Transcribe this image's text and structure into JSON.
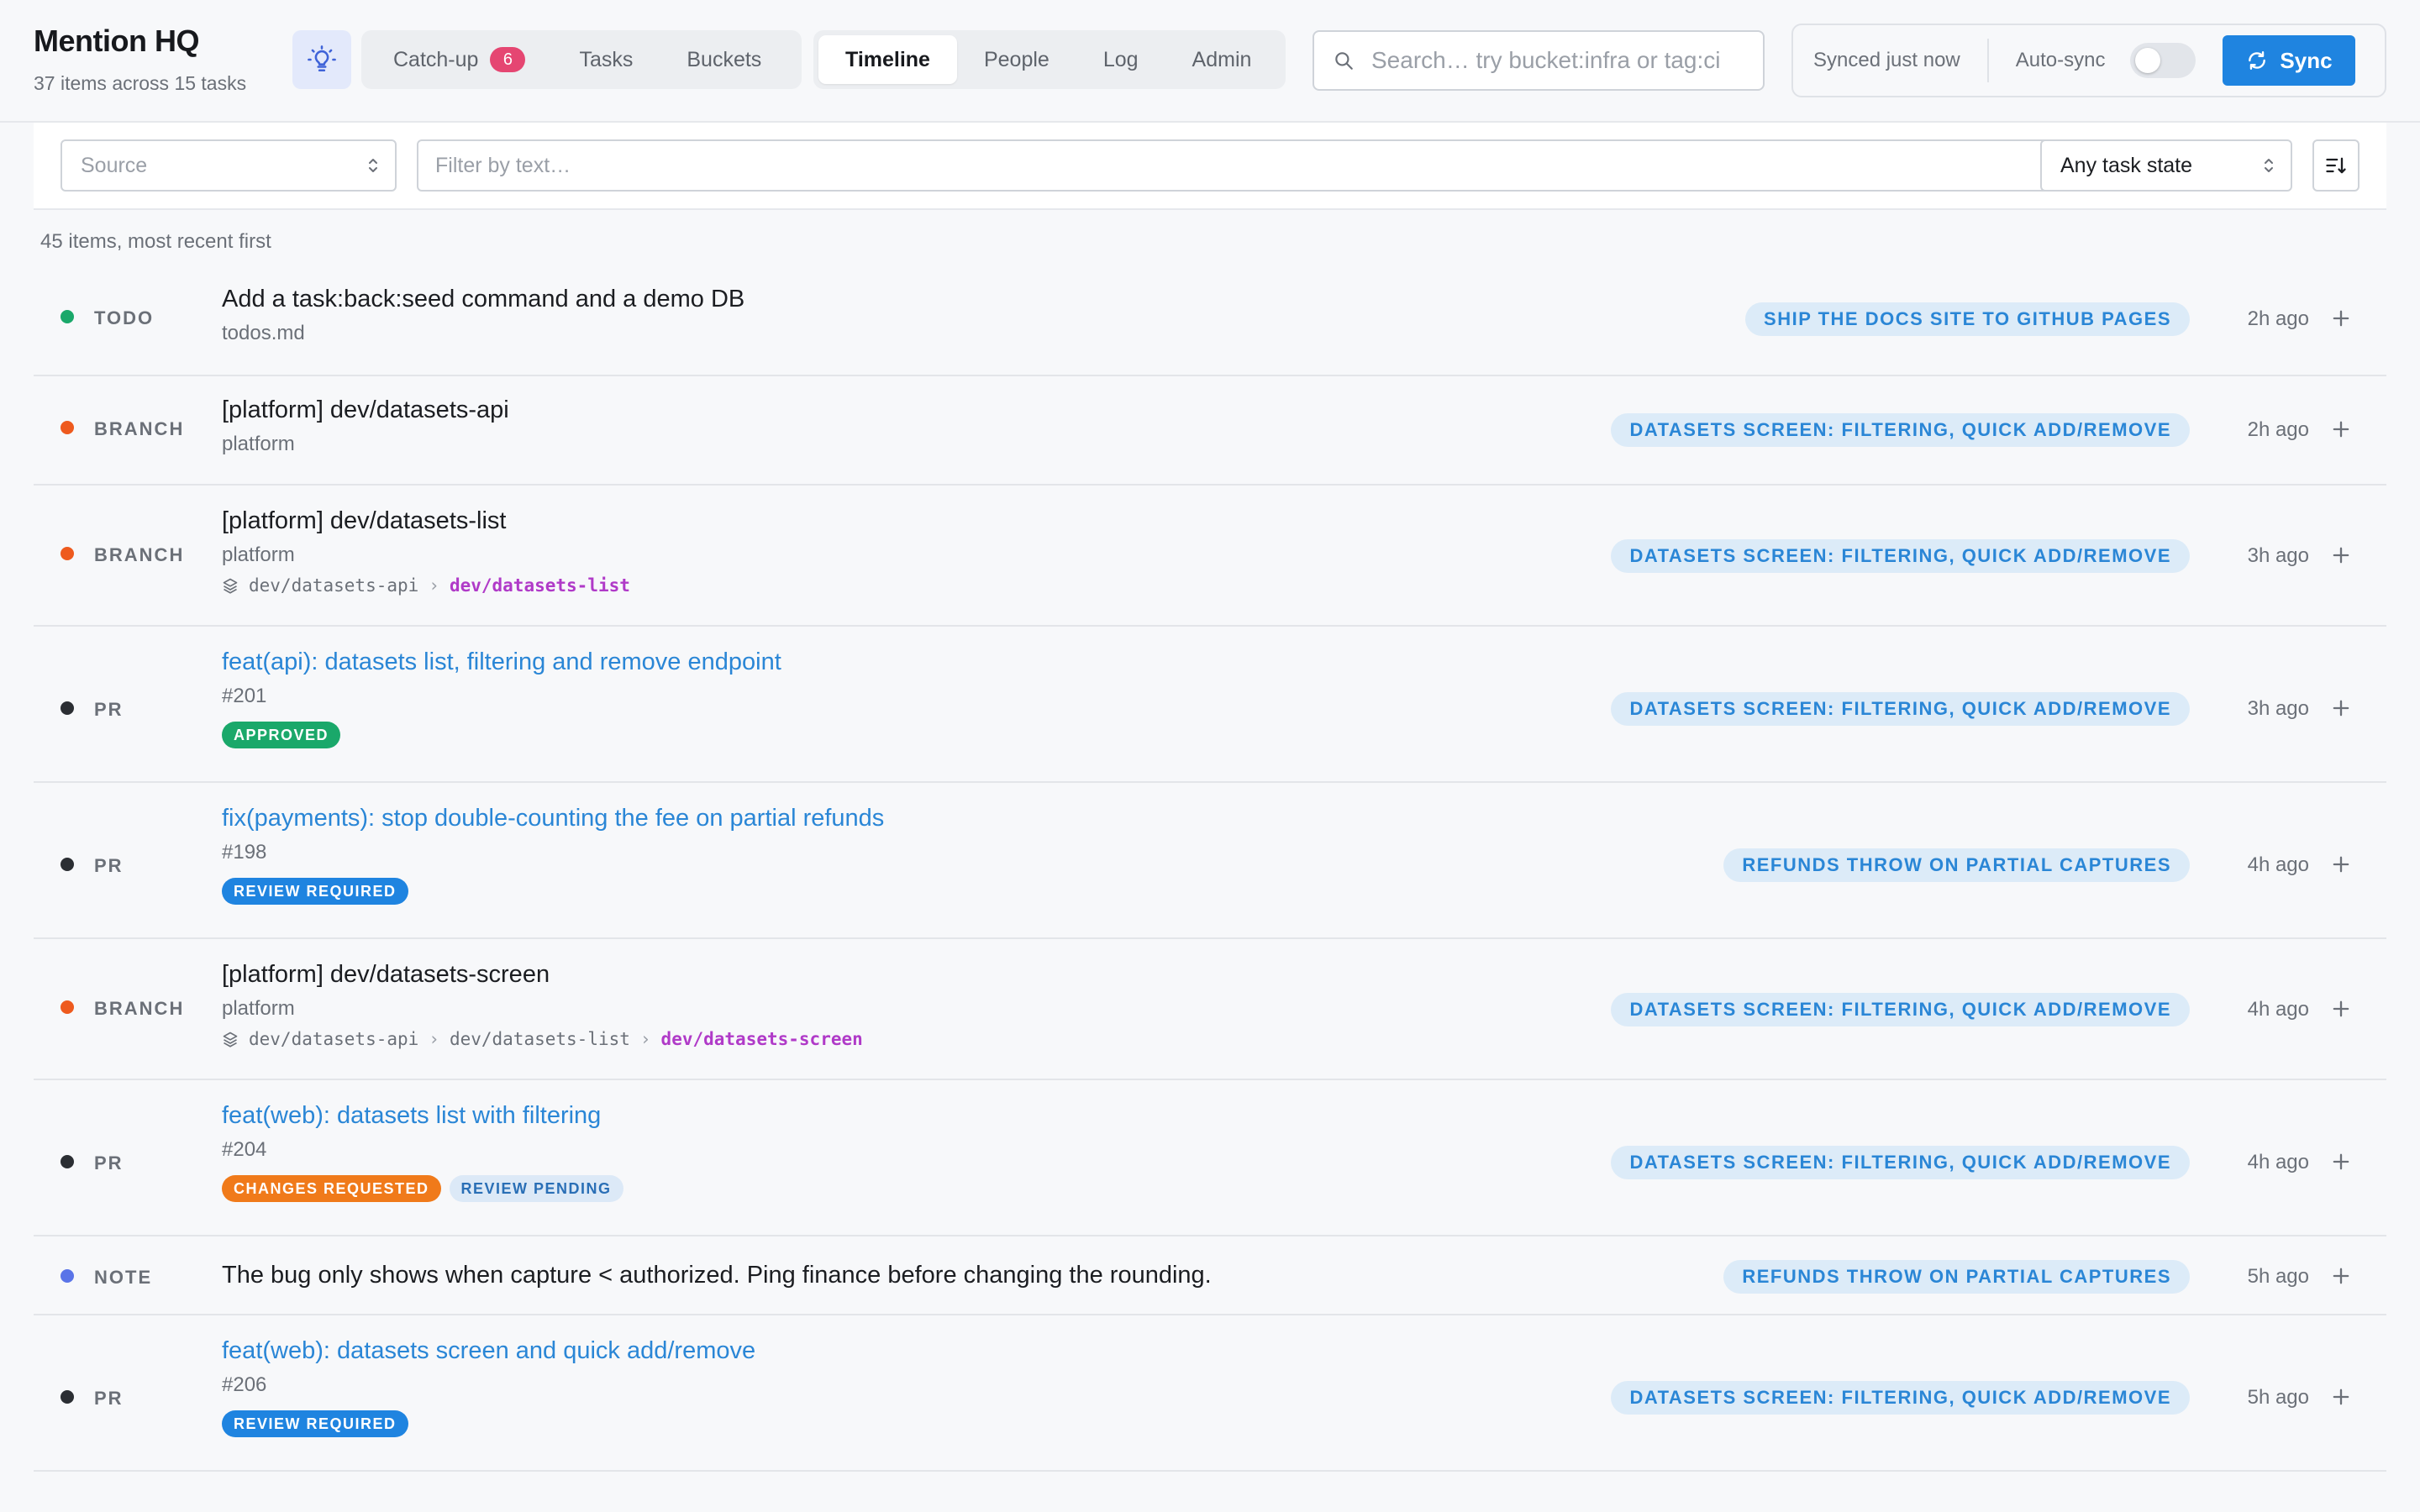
{
  "header": {
    "app_title": "Mention HQ",
    "app_subtitle": "37 items across 15 tasks",
    "tabs_left": [
      {
        "label": "Catch-up",
        "badge": "6"
      },
      {
        "label": "Tasks"
      },
      {
        "label": "Buckets"
      }
    ],
    "tabs_right": [
      {
        "label": "Timeline",
        "active": true
      },
      {
        "label": "People"
      },
      {
        "label": "Log"
      },
      {
        "label": "Admin"
      }
    ],
    "search_placeholder": "Search… try bucket:infra or tag:ci",
    "sync_status": "Synced just now",
    "autosync_label": "Auto-sync",
    "autosync_on": false,
    "sync_button": "Sync"
  },
  "filters": {
    "source_placeholder": "Source",
    "text_placeholder": "Filter by text…",
    "state_value": "Any task state"
  },
  "list": {
    "count_text": "45 items, most recent first",
    "rows": [
      {
        "kind": "TODO",
        "dot": "#1aa86a",
        "title": "Add a task:back:seed command and a demo DB",
        "sub": "todos.md",
        "bucket": "SHIP THE DOCS SITE TO GITHUB PAGES",
        "ago": "2h ago"
      },
      {
        "kind": "BRANCH",
        "dot": "#ee5a1e",
        "title": "[platform] dev/datasets-api",
        "sub": "platform",
        "bucket": "DATASETS SCREEN: FILTERING, QUICK ADD/REMOVE",
        "ago": "2h ago"
      },
      {
        "kind": "BRANCH",
        "dot": "#ee5a1e",
        "title": "[platform] dev/datasets-list",
        "sub": "platform",
        "chain": [
          "dev/datasets-api",
          "dev/datasets-list"
        ],
        "bucket": "DATASETS SCREEN: FILTERING, QUICK ADD/REMOVE",
        "ago": "3h ago"
      },
      {
        "kind": "PR",
        "dot": "#2b2e33",
        "title": "feat(api): datasets list, filtering and remove endpoint",
        "sub": "#201",
        "pills": [
          {
            "label": "APPROVED",
            "tone": "green"
          }
        ],
        "bucket": "DATASETS SCREEN: FILTERING, QUICK ADD/REMOVE",
        "ago": "3h ago"
      },
      {
        "kind": "PR",
        "dot": "#2b2e33",
        "title": "fix(payments): stop double-counting the fee on partial refunds",
        "sub": "#198",
        "pills": [
          {
            "label": "REVIEW REQUIRED",
            "tone": "blue"
          }
        ],
        "bucket": "REFUNDS THROW ON PARTIAL CAPTURES",
        "ago": "4h ago"
      },
      {
        "kind": "BRANCH",
        "dot": "#ee5a1e",
        "title": "[platform] dev/datasets-screen",
        "sub": "platform",
        "chain": [
          "dev/datasets-api",
          "dev/datasets-list",
          "dev/datasets-screen"
        ],
        "bucket": "DATASETS SCREEN: FILTERING, QUICK ADD/REMOVE",
        "ago": "4h ago"
      },
      {
        "kind": "PR",
        "dot": "#2b2e33",
        "title": "feat(web): datasets list with filtering",
        "sub": "#204",
        "pills": [
          {
            "label": "CHANGES REQUESTED",
            "tone": "orange"
          },
          {
            "label": "REVIEW PENDING",
            "tone": "lightblue"
          }
        ],
        "bucket": "DATASETS SCREEN: FILTERING, QUICK ADD/REMOVE",
        "ago": "4h ago"
      },
      {
        "kind": "NOTE",
        "dot": "#5a74e8",
        "title": "The bug only shows when capture < authorized. Ping finance before changing the rounding.",
        "bucket": "REFUNDS THROW ON PARTIAL CAPTURES",
        "ago": "5h ago"
      },
      {
        "kind": "PR",
        "dot": "#2b2e33",
        "title": "feat(web): datasets screen and quick add/remove",
        "sub": "#206",
        "pills": [
          {
            "label": "REVIEW REQUIRED",
            "tone": "blue"
          }
        ],
        "bucket": "DATASETS SCREEN: FILTERING, QUICK ADD/REMOVE",
        "ago": "5h ago"
      }
    ]
  }
}
